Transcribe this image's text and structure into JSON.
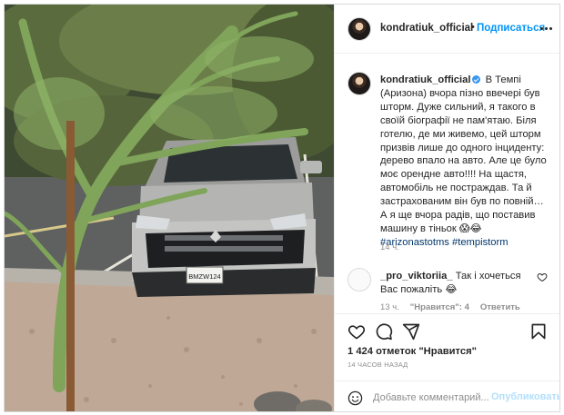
{
  "header": {
    "username": "kondratiuk_official",
    "separator": "•",
    "follow_label": "Подписаться"
  },
  "caption": {
    "username": "kondratiuk_official",
    "text": "В Темпі (Аризона) вчора пізно ввечері був шторм. Дуже сильний, я такого в своїй біографії не пам'ятаю. Біля готелю, де ми живемо, цей шторм призвів лише до одного інциденту: дерево впало на авто. Але це було моє орендне авто!!!! На щастя, автомобіль не постраждав. Та й застрахованим він був по повній… А я ще вчора радів, що поставив машину в тіньок 😱😂",
    "hashtags": [
      "#arizonastotms",
      "#tempistorm"
    ],
    "time": "14 ч."
  },
  "comment": {
    "username": "_pro_viktoriia_",
    "text": "Так і хочеться Вас пожаліть 😂",
    "time": "13 ч.",
    "likes": "\"Нравится\": 4",
    "reply": "Ответить"
  },
  "post": {
    "likes": "1 424 отметок \"Нравится\"",
    "time": "14 ЧАСОВ НАЗАД"
  },
  "add_comment": {
    "placeholder": "Добавьте комментарий...",
    "publish_label": "Опубликовать"
  },
  "photo": {
    "license_plate": "BMZW124"
  },
  "icons": {
    "more": "more-options-icon",
    "verified": "verified-badge-icon",
    "like": "heart-icon",
    "comment": "comment-icon",
    "share": "share-icon",
    "save": "bookmark-icon",
    "emoji": "emoji-icon"
  },
  "colors": {
    "link": "#0095f6",
    "hashtag": "#00376b",
    "secondary_text": "#8e8e8e",
    "border": "#dbdbdb"
  }
}
